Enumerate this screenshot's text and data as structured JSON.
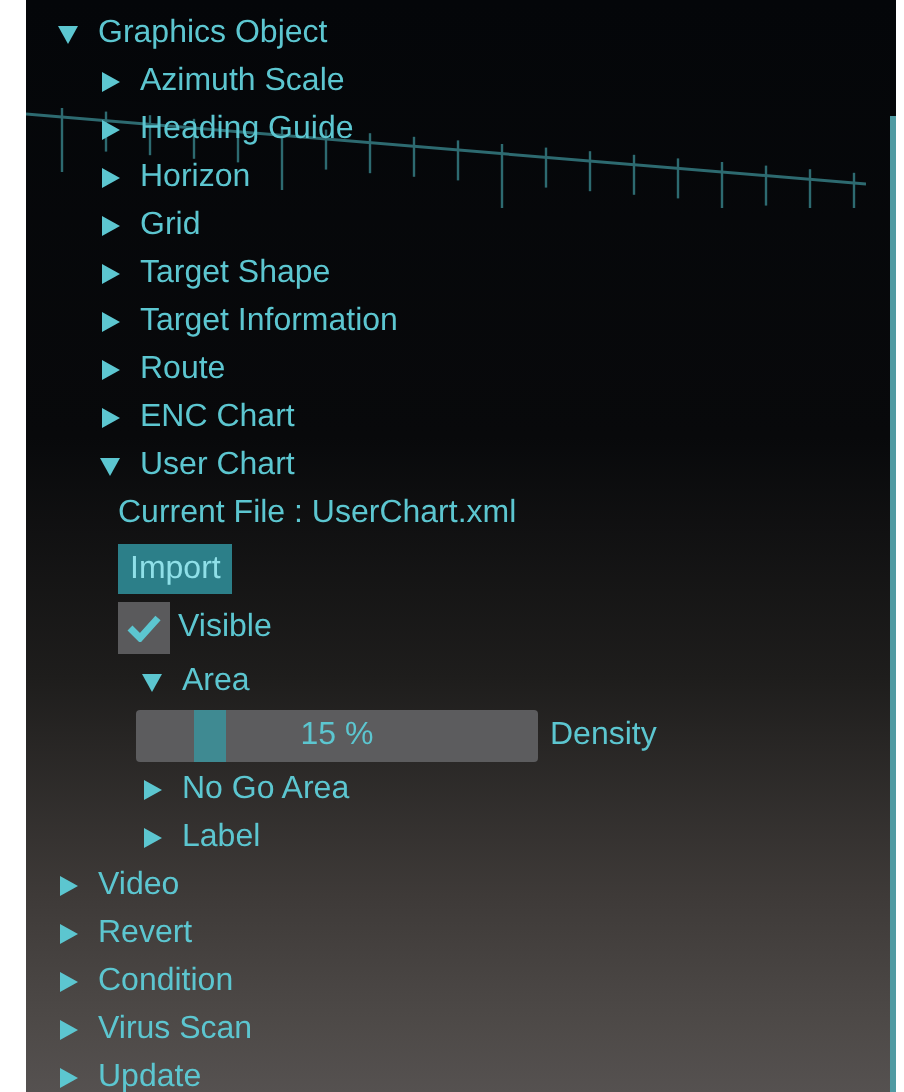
{
  "tree": [
    {
      "kind": "node",
      "label": "Graphics Object",
      "expanded": true,
      "children": [
        {
          "kind": "node",
          "label": "Azimuth Scale",
          "expanded": false
        },
        {
          "kind": "node",
          "label": "Heading Guide",
          "expanded": false
        },
        {
          "kind": "node",
          "label": "Horizon",
          "expanded": false
        },
        {
          "kind": "node",
          "label": "Grid",
          "expanded": false
        },
        {
          "kind": "node",
          "label": "Target Shape",
          "expanded": false
        },
        {
          "kind": "node",
          "label": "Target Information",
          "expanded": false
        },
        {
          "kind": "node",
          "label": "Route",
          "expanded": false
        },
        {
          "kind": "node",
          "label": "ENC Chart",
          "expanded": false
        },
        {
          "kind": "node",
          "label": "User Chart",
          "expanded": true,
          "children": [
            {
              "kind": "text",
              "label": "Current File : UserChart.xml"
            },
            {
              "kind": "button",
              "label": "Import"
            },
            {
              "kind": "checkbox",
              "label": "Visible",
              "checked": true
            },
            {
              "kind": "node",
              "label": "Area",
              "expanded": true,
              "children": [
                {
                  "kind": "slider",
                  "value": "15 %",
                  "level": 0.15,
                  "label": "Density"
                }
              ]
            },
            {
              "kind": "node",
              "label": "No Go Area",
              "expanded": false
            },
            {
              "kind": "node",
              "label": "Label",
              "expanded": false
            }
          ]
        }
      ]
    },
    {
      "kind": "node",
      "label": "Video",
      "expanded": false
    },
    {
      "kind": "node",
      "label": "Revert",
      "expanded": false
    },
    {
      "kind": "node",
      "label": "Condition",
      "expanded": false
    },
    {
      "kind": "node",
      "label": "Virus Scan",
      "expanded": false
    },
    {
      "kind": "node",
      "label": "Update",
      "expanded": false
    }
  ]
}
